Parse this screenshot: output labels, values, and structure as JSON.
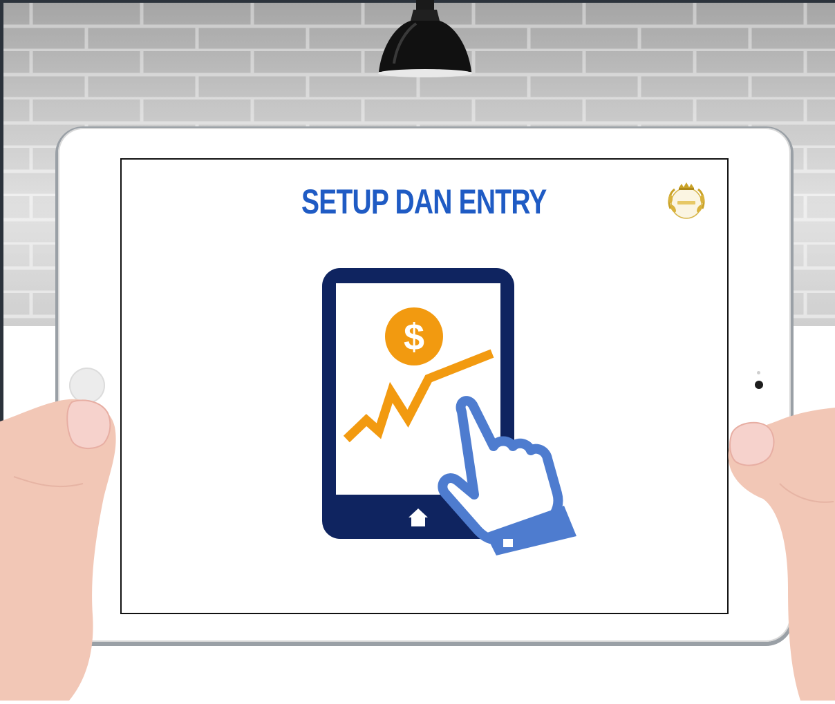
{
  "scene": {
    "title": "SETUP DAN ENTRY",
    "colors": {
      "title_blue": "#1f5bc4",
      "navy": "#0f2460",
      "orange": "#f29a10",
      "hand_blue": "#4e7ccf",
      "gold": "#c9a227"
    },
    "icons": {
      "lamp": "pendant-lamp-icon",
      "logo": "gold-laurel-crown-logo",
      "device": "tablet-icon",
      "coin": "dollar-coin-icon",
      "trend": "trend-line-icon",
      "hand": "pointing-hand-icon",
      "home": "home-icon"
    }
  }
}
